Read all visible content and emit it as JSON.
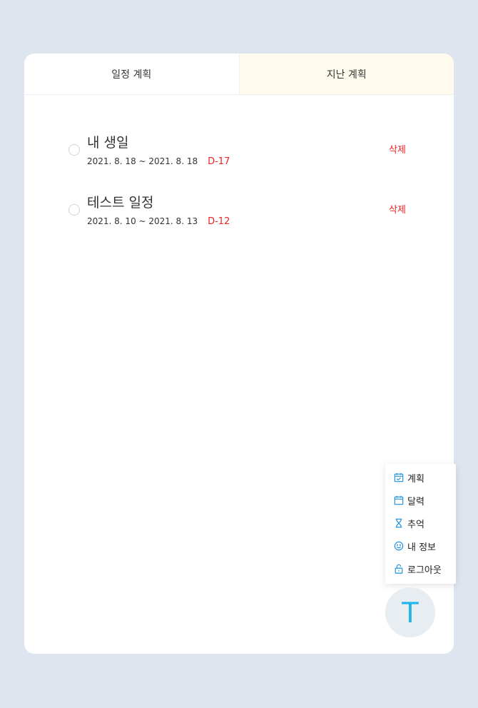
{
  "tabs": [
    {
      "label": "일정 계획"
    },
    {
      "label": "지난 계획"
    }
  ],
  "plans": [
    {
      "title": "내 생일",
      "range": "2021. 8. 18 ~ 2021. 8. 18",
      "dday": "D-17",
      "delete_label": "삭제"
    },
    {
      "title": "테스트 일정",
      "range": "2021. 8. 10 ~ 2021. 8. 13",
      "dday": "D-12",
      "delete_label": "삭제"
    }
  ],
  "menu": {
    "items": [
      {
        "label": "계획",
        "icon": "calendar-check-icon"
      },
      {
        "label": "달력",
        "icon": "calendar-icon"
      },
      {
        "label": "추억",
        "icon": "hourglass-icon"
      },
      {
        "label": "내 정보",
        "icon": "smile-icon"
      },
      {
        "label": "로그아웃",
        "icon": "unlock-icon"
      }
    ]
  },
  "fab": {
    "label": "T"
  },
  "colors": {
    "accent": "#1a8fe0",
    "danger": "#ee2222",
    "active_tab": "#fffbed",
    "background": "#dfe5ee"
  }
}
